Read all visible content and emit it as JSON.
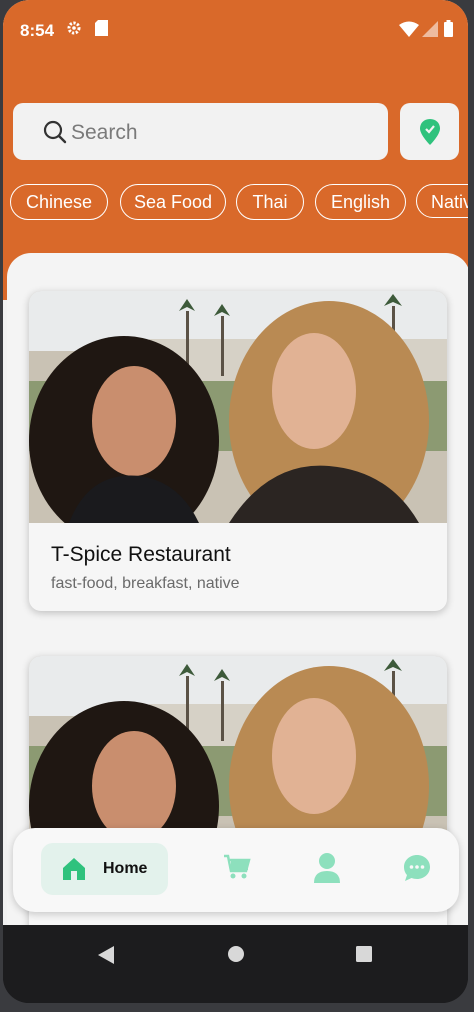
{
  "status_bar": {
    "time": "8:54"
  },
  "search": {
    "placeholder": "Search"
  },
  "categories": [
    "Chinese",
    "Sea Food",
    "Thai",
    "English",
    "Native"
  ],
  "restaurants": [
    {
      "name": "T-Spice Restaurant",
      "tags": "fast-food, breakfast, native"
    },
    {
      "name": "",
      "tags": ""
    }
  ],
  "bottom_nav": {
    "home_label": "Home"
  },
  "colors": {
    "header": "#d9692a",
    "accent_green": "#2fc27d",
    "nav_icon": "#8de0bd"
  }
}
